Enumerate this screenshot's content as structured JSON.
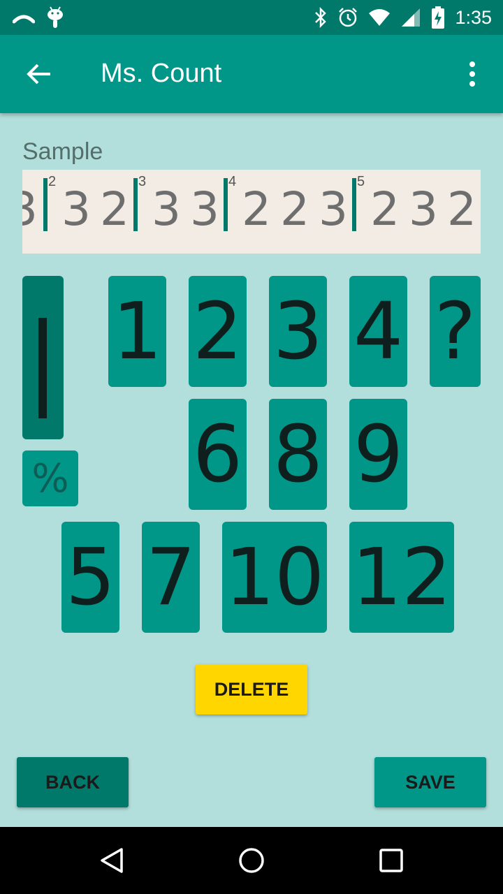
{
  "status_bar": {
    "time": "1:35",
    "icons": [
      "cast-icon",
      "android-icon",
      "bluetooth-icon",
      "alarm-icon",
      "wifi-icon",
      "signal-icon",
      "battery-charging-icon"
    ]
  },
  "toolbar": {
    "title": "Ms. Count",
    "back_icon": "arrow-back-icon",
    "menu_icon": "more-vert-icon"
  },
  "sample": {
    "label": "Sample",
    "partial_digit": "3",
    "groups": [
      {
        "bar_number": "2",
        "digits": [
          "3",
          "2"
        ]
      },
      {
        "bar_number": "3",
        "digits": [
          "3",
          "3"
        ]
      },
      {
        "bar_number": "4",
        "digits": [
          "2",
          "2",
          "3"
        ]
      },
      {
        "bar_number": "5",
        "digits": [
          "2",
          "3",
          "2"
        ]
      }
    ]
  },
  "keypad": {
    "row1": [
      "1",
      "2",
      "3",
      "4",
      "?"
    ],
    "row2": [
      "6",
      "8",
      "9"
    ],
    "row3": [
      "5",
      "7",
      "10",
      "12"
    ],
    "bar_key_icon": "bar-line-icon",
    "percent_key": "%"
  },
  "buttons": {
    "delete": "DELETE",
    "back": "BACK",
    "save": "SAVE"
  },
  "colors": {
    "background": "#b2dfdb",
    "primary": "#009688",
    "primary_dark": "#00796b",
    "accent": "#ffd600",
    "sample_bg": "#f2ece4"
  },
  "nav_bar": {
    "icons": [
      "nav-back-icon",
      "nav-home-icon",
      "nav-recents-icon"
    ]
  }
}
